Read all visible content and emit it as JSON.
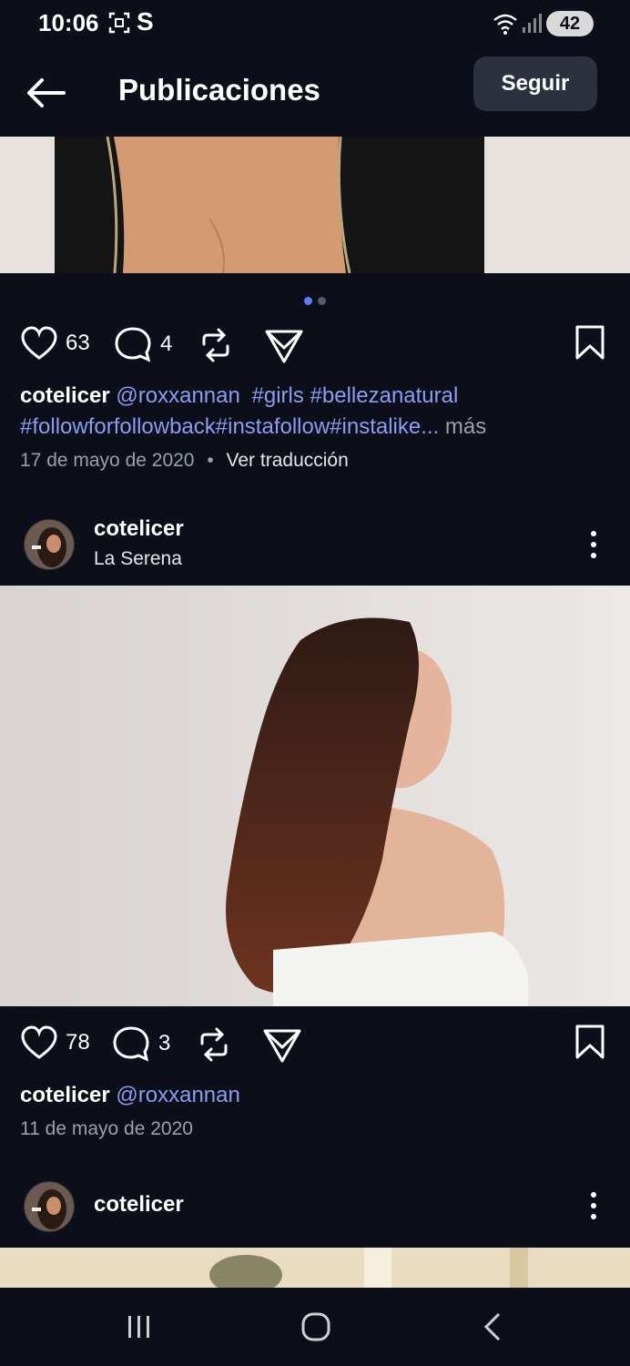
{
  "status_bar": {
    "time": "10:06",
    "battery": "42",
    "icons": [
      "screenshot-icon",
      "s-app-icon",
      "wifi-icon",
      "signal-icon",
      "battery-icon"
    ]
  },
  "header": {
    "title": "Publicaciones",
    "follow_label": "Seguir"
  },
  "post1": {
    "likes": "63",
    "comments": "4",
    "caption_user": "cotelicer",
    "caption_mention": "@roxxannan",
    "caption_tags_line1": "#girls #bellezanatural",
    "caption_tags_line2": "#followforfollowback#instafollow#instalike...",
    "more_label": "más",
    "date": "17 de mayo de 2020",
    "separator": "•",
    "translate_label": "Ver traducción"
  },
  "post2": {
    "username": "cotelicer",
    "location": "La Serena",
    "likes": "78",
    "comments": "3",
    "caption_user": "cotelicer",
    "caption_mention": "@roxxannan",
    "date": "11 de mayo de 2020"
  },
  "post3": {
    "username": "cotelicer"
  },
  "colors": {
    "background": "#0c0f1a",
    "link": "#8c9cf0",
    "muted": "#9aa0aa",
    "active_dot": "#5b7cf7"
  }
}
